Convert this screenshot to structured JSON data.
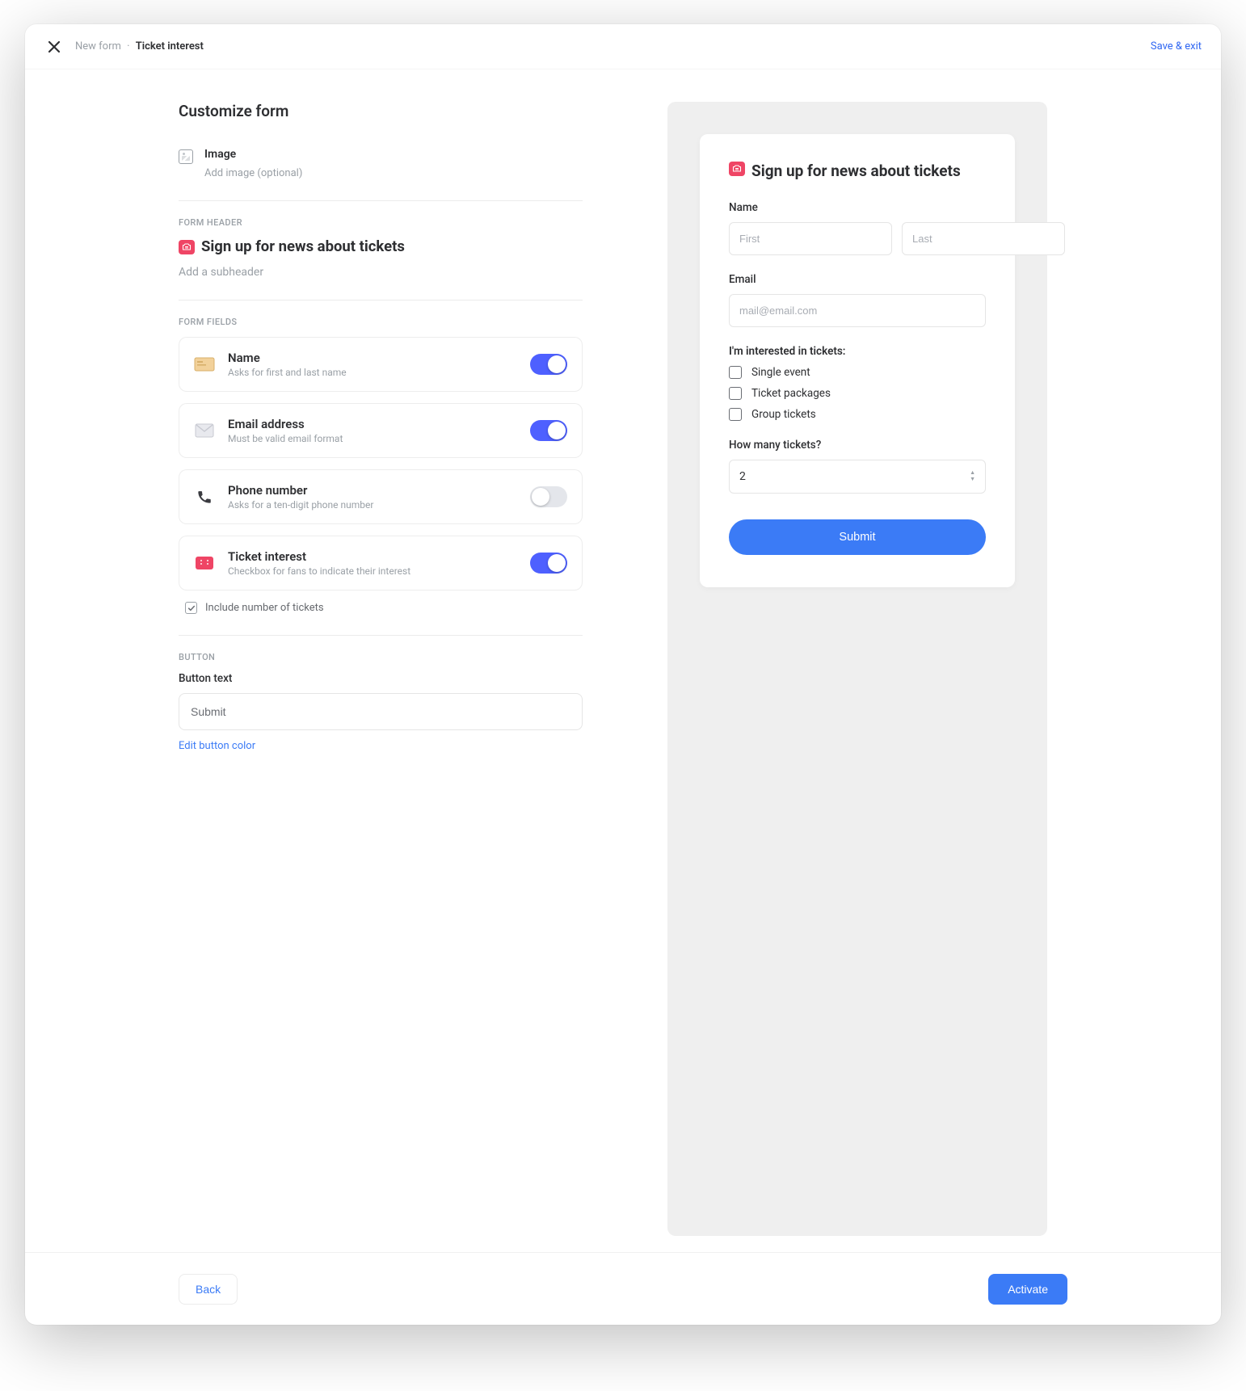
{
  "topbar": {
    "breadcrumb_prefix": "New form",
    "breadcrumb_current": "Ticket interest",
    "save_exit": "Save & exit"
  },
  "page": {
    "title": "Customize form"
  },
  "image_section": {
    "label": "Image",
    "sub": "Add image (optional)"
  },
  "form_header": {
    "section_label": "FORM HEADER",
    "heading": "Sign up for news about tickets",
    "subheader_placeholder": "Add a subheader"
  },
  "form_fields": {
    "section_label": "FORM FIELDS",
    "items": [
      {
        "title": "Name",
        "desc": "Asks for first and last name",
        "on": true,
        "icon": "card"
      },
      {
        "title": "Email address",
        "desc": "Must be valid email format",
        "on": true,
        "icon": "mail"
      },
      {
        "title": "Phone number",
        "desc": "Asks for a ten-digit phone number",
        "on": false,
        "icon": "phone"
      },
      {
        "title": "Ticket interest",
        "desc": "Checkbox for fans to indicate their interest",
        "on": true,
        "icon": "ticket"
      }
    ],
    "include_tickets": {
      "label": "Include number of tickets",
      "checked": true
    }
  },
  "button_section": {
    "section_label": "BUTTON",
    "label": "Button text",
    "value": "Submit",
    "edit_color": "Edit button color"
  },
  "preview": {
    "title": "Sign up for news about tickets",
    "name_label": "Name",
    "first_placeholder": "First",
    "last_placeholder": "Last",
    "email_label": "Email",
    "email_placeholder": "mail@email.com",
    "interest_label": "I'm interested in tickets:",
    "interest_options": [
      "Single event",
      "Ticket packages",
      "Group tickets"
    ],
    "qty_label": "How many tickets?",
    "qty_value": "2",
    "submit_label": "Submit"
  },
  "footer": {
    "back": "Back",
    "activate": "Activate"
  },
  "colors": {
    "accent_toggle": "#4e60ff",
    "accent_button": "#3b7bf6",
    "badge": "#ef4565"
  }
}
